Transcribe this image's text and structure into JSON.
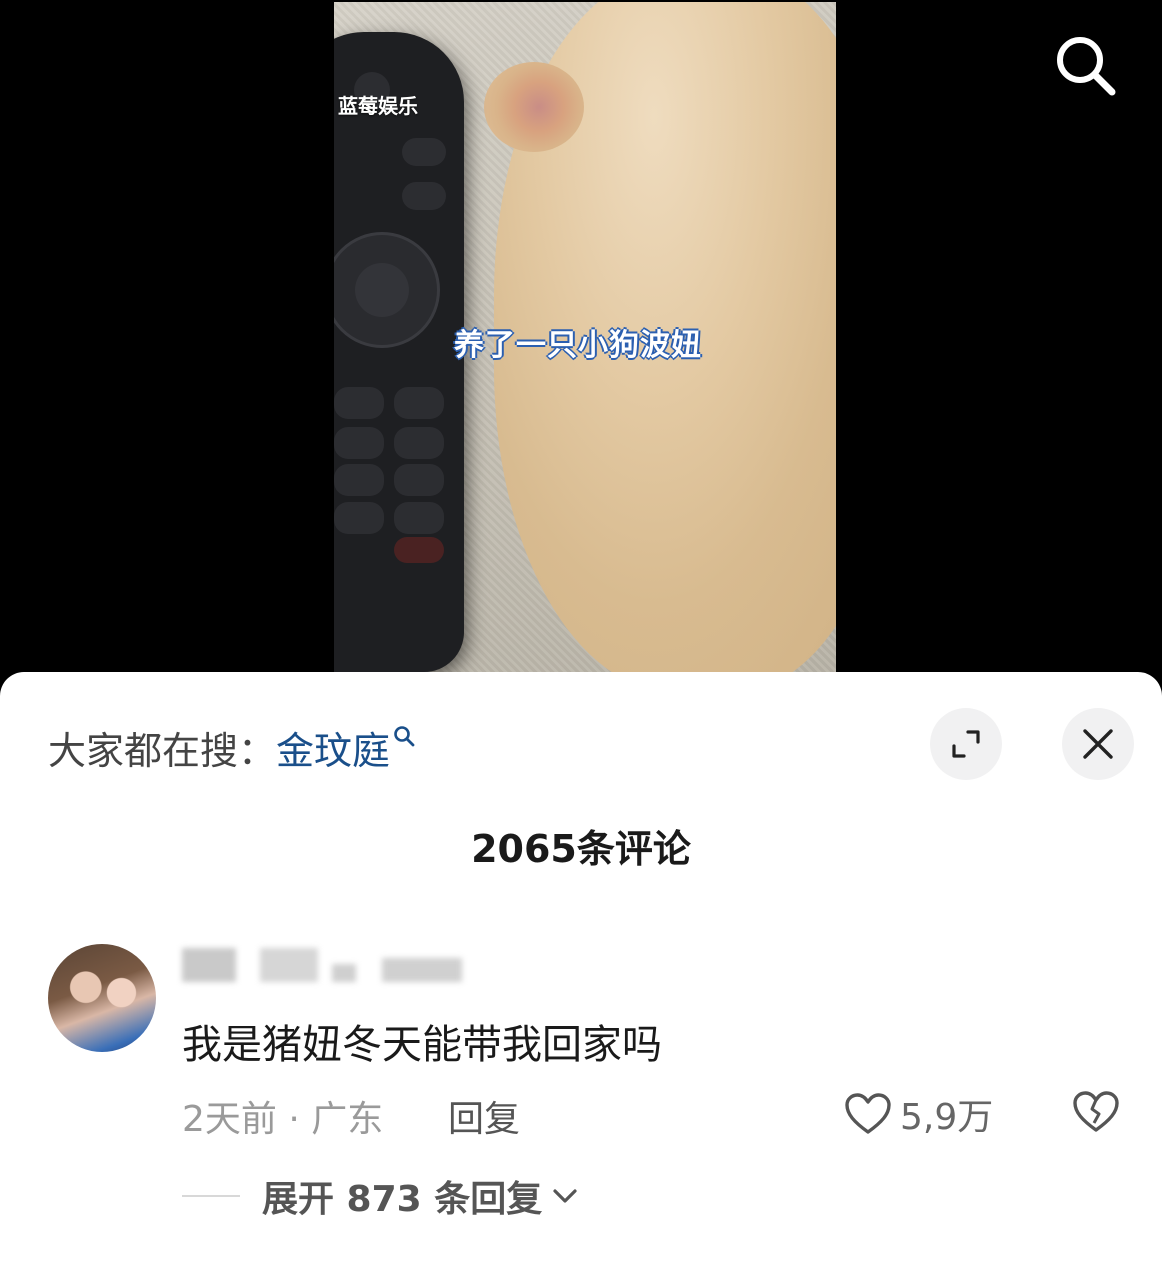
{
  "video": {
    "watermark": "蓝莓娱乐",
    "caption": "养了一只小狗波妞"
  },
  "icons": {
    "search": "search-icon",
    "expand": "expand-icon",
    "close": "close-icon",
    "like": "heart-icon",
    "dislike": "broken-heart-icon",
    "chevron": "chevron-down-icon"
  },
  "sheet": {
    "hot_search_prefix": "大家都在搜：",
    "hot_search_term": "金玟庭",
    "comment_count": "2065条评论"
  },
  "comment": {
    "text": "我是猪妞冬天能带我回家吗",
    "meta": "2天前 · 广东",
    "reply_label": "回复",
    "like_count": "5,9万",
    "expand_replies": "展开 873 条回复"
  },
  "colors": {
    "accent_link": "#1a4f8a",
    "caption_outline": "#2b5fb0"
  }
}
